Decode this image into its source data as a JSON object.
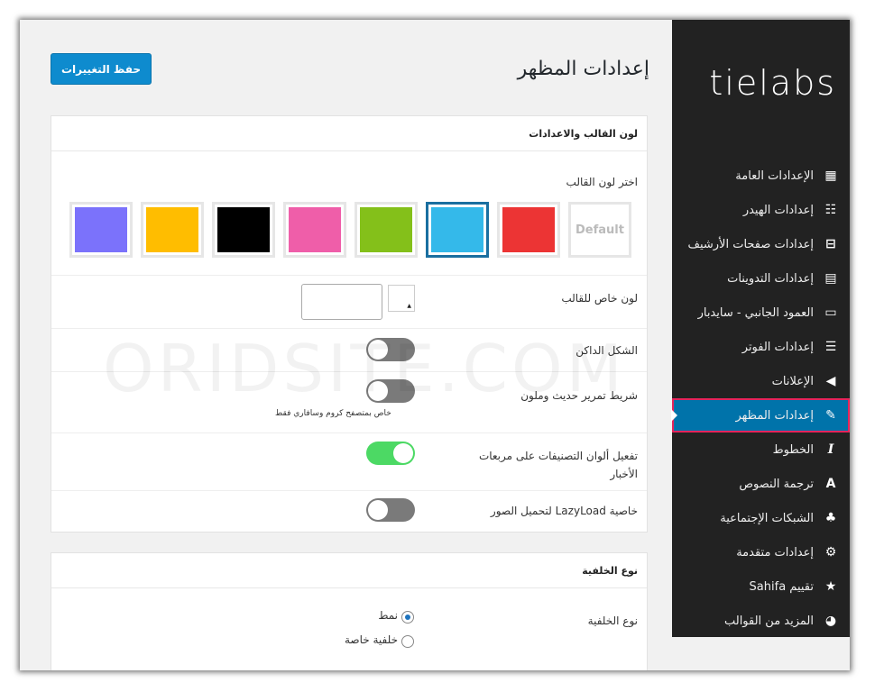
{
  "header": {
    "title": "إعدادات المظهر",
    "save_label": "حفظ التغييرات"
  },
  "logo": "tielabs",
  "sidebar": {
    "items": [
      {
        "label": "الإعدادات العامة",
        "icon": "layout-icon"
      },
      {
        "label": "إعدادات الهيدر",
        "icon": "header-grid-icon"
      },
      {
        "label": "إعدادات صفحات الأرشيف",
        "icon": "archive-icon"
      },
      {
        "label": "إعدادات التدوينات",
        "icon": "document-icon"
      },
      {
        "label": "العمود الجانبي - سايدبار",
        "icon": "sidebar-icon"
      },
      {
        "label": "إعدادات الفوتر",
        "icon": "footer-icon"
      },
      {
        "label": "الإعلانات",
        "icon": "megaphone-icon"
      },
      {
        "label": "إعدادات المظهر",
        "icon": "brush-icon",
        "active": true
      },
      {
        "label": "الخطوط",
        "icon": "italic-icon"
      },
      {
        "label": "ترجمة النصوص",
        "icon": "letter-a-icon"
      },
      {
        "label": "الشبكات الإجتماعية",
        "icon": "sitemap-icon"
      },
      {
        "label": "إعدادات متقدمة",
        "icon": "wrench-icon"
      },
      {
        "label": "تقييم Sahifa",
        "icon": "star-icon"
      },
      {
        "label": "المزيد من القوالب",
        "icon": "pie-icon"
      }
    ]
  },
  "panel1": {
    "title": "لون القالب والاعدادات",
    "choose_color_label": "اختر لون القالب",
    "swatches": [
      {
        "name": "default",
        "label": "Default",
        "color": "#ffffff"
      },
      {
        "name": "red",
        "color": "#ec3434"
      },
      {
        "name": "skyblue",
        "color": "#34b9ea",
        "selected": true
      },
      {
        "name": "green",
        "color": "#84c01a"
      },
      {
        "name": "pink",
        "color": "#ef5ea9"
      },
      {
        "name": "black",
        "color": "#000000"
      },
      {
        "name": "yellow",
        "color": "#ffbd00"
      },
      {
        "name": "purple",
        "color": "#7b72fb"
      }
    ],
    "custom_color_label": "لون خاص للقالب",
    "dark_skin_label": "الشكل الداكن",
    "dark_skin_on": false,
    "scrollbar_label": "شريط تمرير حديث وملون",
    "scrollbar_note": "خاص بمتصفح كروم وسافاري فقط",
    "scrollbar_on": false,
    "category_colors_label": "تفعيل ألوان التصنيفات على مربعات الأخبار",
    "category_colors_on": true,
    "lazyload_label": "خاصية LazyLoad لتحميل الصور",
    "lazyload_on": false
  },
  "panel2": {
    "title": "نوع الخلفية",
    "bg_type_label": "نوع الخلفية",
    "options": [
      {
        "label": "نمط",
        "checked": true
      },
      {
        "label": "خلفية خاصة",
        "checked": false
      }
    ]
  },
  "watermark": "ORIDSITE.COM"
}
